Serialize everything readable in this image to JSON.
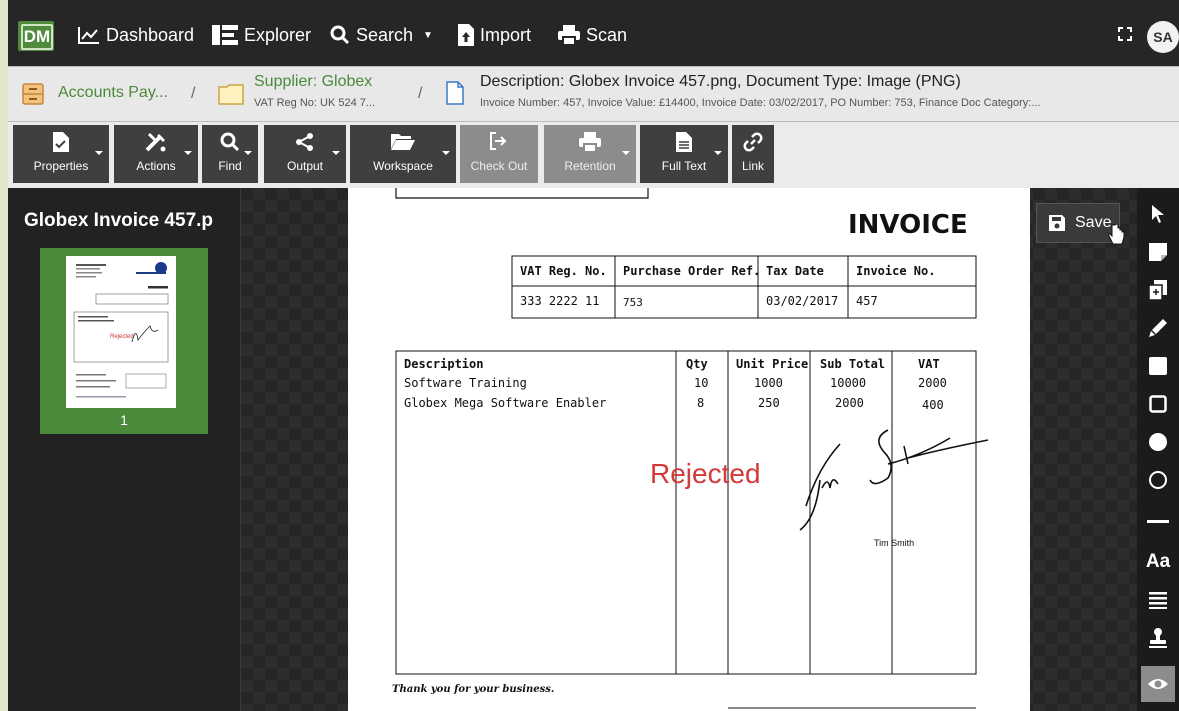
{
  "topbar": {
    "logo_text": "DM",
    "nav": [
      {
        "label": "Dashboard",
        "icon": "chart-line-icon"
      },
      {
        "label": "Explorer",
        "icon": "tree-icon"
      },
      {
        "label": "Search",
        "icon": "search-icon"
      },
      {
        "label": "Import",
        "icon": "upload-file-icon"
      },
      {
        "label": "Scan",
        "icon": "printer-icon"
      }
    ],
    "avatar": "SA"
  },
  "breadcrumb": {
    "root": "Accounts Pay...",
    "supplier": "Supplier: Globex",
    "supplier_sub": "VAT Reg No: UK 524 7...",
    "description": "Description: Globex Invoice 457.png, Document Type: Image (PNG)",
    "description_sub": "Invoice Number: 457, Invoice Value: £14400, Invoice Date: 03/02/2017, PO Number: 753, Finance Doc Category:..."
  },
  "toolbar": [
    {
      "label": "Properties",
      "icon": "file-check-icon"
    },
    {
      "label": "Actions",
      "icon": "tools-icon"
    },
    {
      "label": "Find",
      "icon": "search-icon"
    },
    {
      "label": "Output",
      "icon": "share-icon"
    },
    {
      "label": "Workspace",
      "icon": "folder-open-icon"
    },
    {
      "label": "Check Out",
      "icon": "sign-out-icon"
    },
    {
      "label": "Retention",
      "icon": "printer-icon"
    },
    {
      "label": "Full Text",
      "icon": "file-text-icon"
    },
    {
      "label": "Link",
      "icon": "link-icon"
    }
  ],
  "left_panel": {
    "title": "Globex Invoice 457.p",
    "page_number": "1"
  },
  "viewer": {
    "save_label": "Save"
  },
  "invoice": {
    "title": "INVOICE",
    "info_headers": [
      "VAT Reg. No.",
      "Purchase Order Ref.",
      "Tax Date",
      "Invoice No."
    ],
    "info_values": [
      "333 2222 11",
      "753",
      "03/02/2017",
      "457"
    ],
    "item_headers": [
      "Description",
      "Qty",
      "Unit Price",
      "Sub Total",
      "VAT"
    ],
    "items": [
      [
        "Software Training",
        "10",
        "1000",
        "10000",
        "2000"
      ],
      [
        "Globex Mega Software Enabler",
        "8",
        "250",
        "2000",
        "400"
      ]
    ],
    "stamp": "Rejected",
    "signatory": "Tim Smith",
    "footer": "Thank you for your business."
  }
}
